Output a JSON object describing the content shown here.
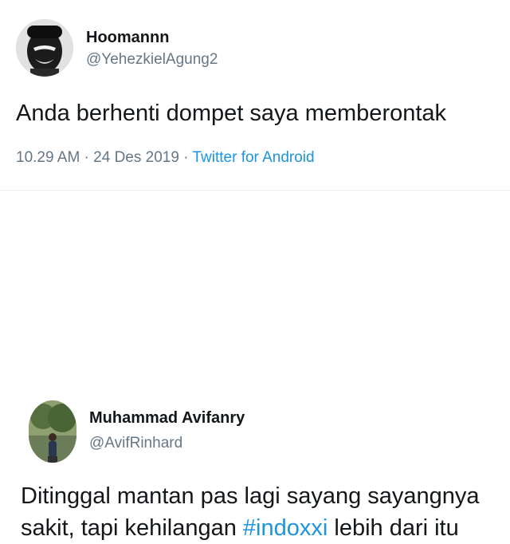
{
  "tweets": [
    {
      "display_name": "Hoomannn",
      "handle": "@YehezkielAgung2",
      "text": "Anda berhenti dompet saya memberontak",
      "time": "10.29 AM · 24 Des 2019",
      "separator": " · ",
      "source": "Twitter for Android"
    },
    {
      "display_name": "Muhammad Avifanry",
      "handle": "@AvifRinhard",
      "text_line1": "Ditinggal mantan pas lagi sayang sayangnya",
      "text_line2_before": "sakit, tapi kehilangan ",
      "hashtag": "#indoxxi",
      "text_line2_after": " lebih dari itu"
    }
  ],
  "colors": {
    "text": "#14171a",
    "secondary": "#657786",
    "link": "#1b95e0",
    "divider": "#e6ecf0"
  },
  "icons": {
    "avatar_1": "user-avatar-photo",
    "avatar_2": "user-avatar-photo"
  }
}
